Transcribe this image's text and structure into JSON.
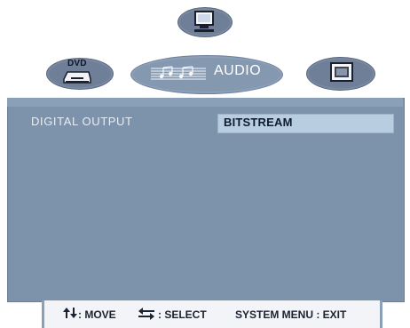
{
  "tabs": [
    {
      "id": "system",
      "icon": "monitor-icon"
    },
    {
      "id": "dvd",
      "label": "DVD",
      "icon": "dvd-player-icon"
    },
    {
      "id": "audio",
      "label": "AUDIO",
      "icon": "music-notes-icon"
    },
    {
      "id": "video",
      "icon": "tv-icon"
    }
  ],
  "menu": {
    "row_label": "DIGITAL OUTPUT",
    "row_value": "BITSTREAM"
  },
  "footer": {
    "move": ": MOVE",
    "select": ": SELECT",
    "exit": "SYSTEM MENU : EXIT"
  },
  "colors": {
    "panel": "#7d92ab",
    "tab": "#6f7f98",
    "selected_value": "#b9cde0"
  }
}
